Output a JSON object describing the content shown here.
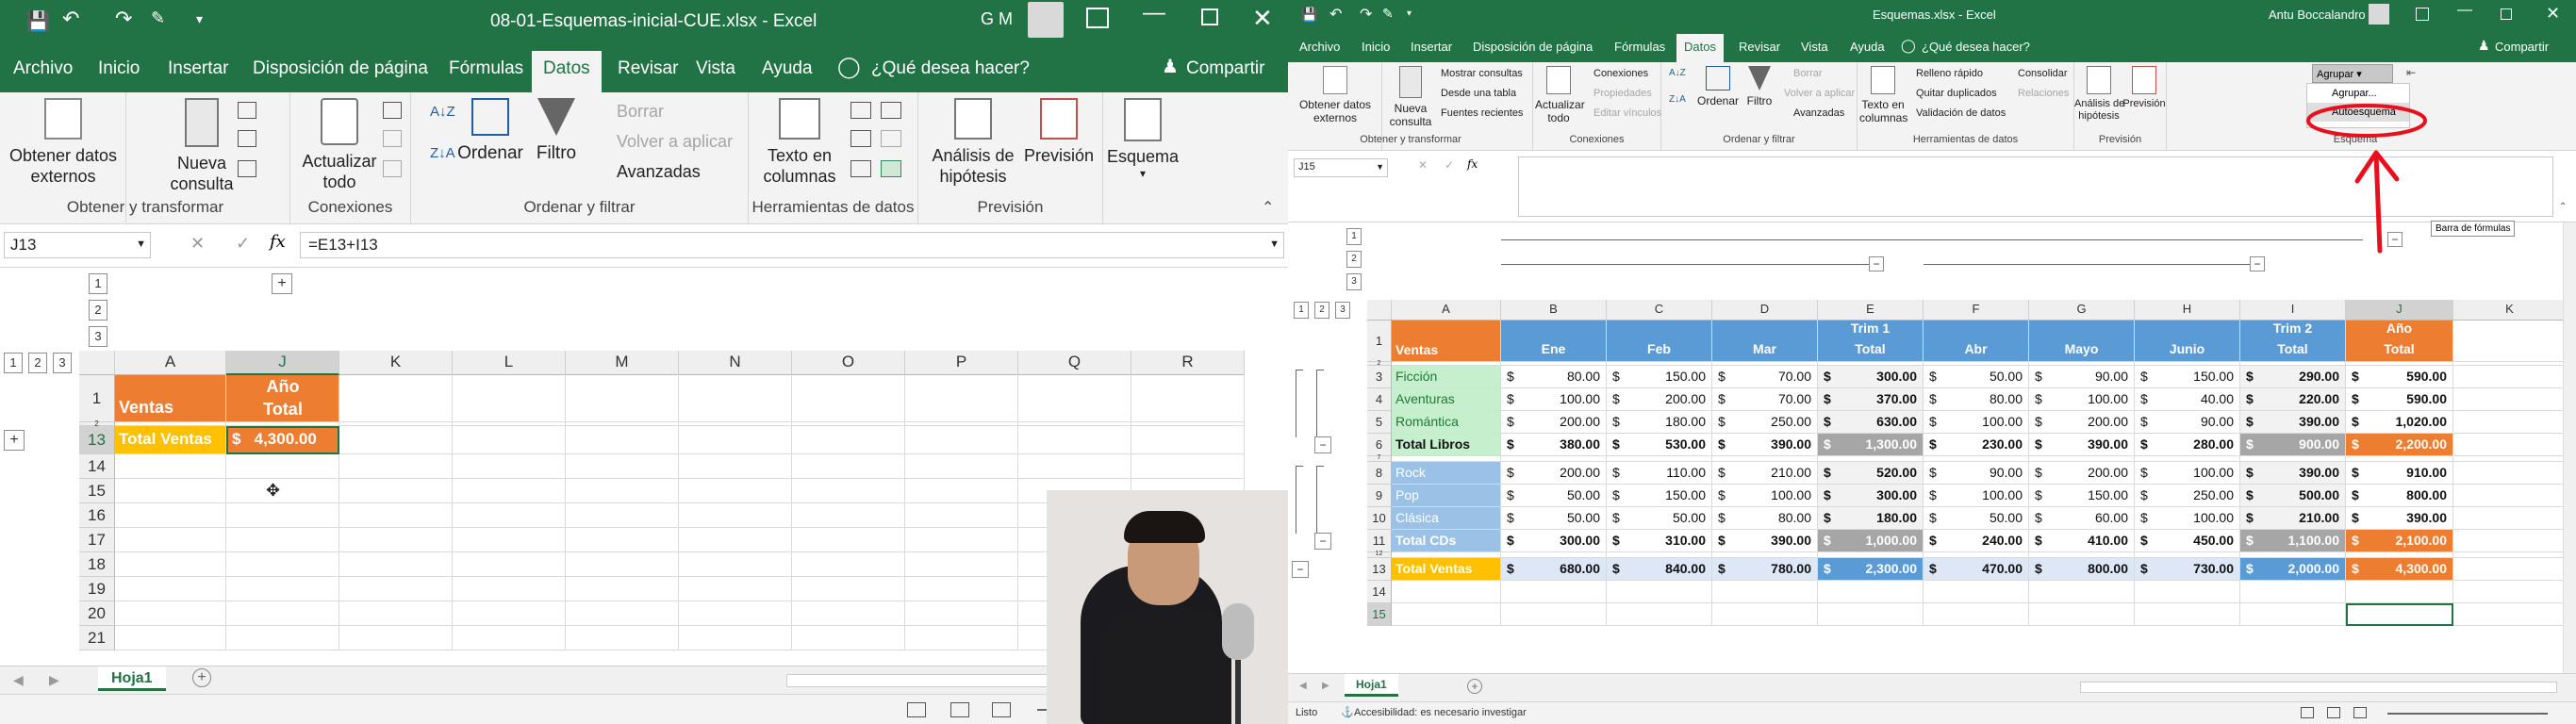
{
  "left": {
    "title": "08-01-Esquemas-inicial-CUE.xlsx  -  Excel",
    "user_initials": "G M",
    "tabs": [
      "Archivo",
      "Inicio",
      "Insertar",
      "Disposición de página",
      "Fórmulas",
      "Datos",
      "Revisar",
      "Vista",
      "Ayuda"
    ],
    "tell_me": "¿Qué desea hacer?",
    "share": "Compartir",
    "ribbon": {
      "obtener_line1": "Obtener datos",
      "obtener_line2": "externos",
      "nueva_line1": "Nueva",
      "nueva_line2": "consulta",
      "actualizar_line1": "Actualizar",
      "actualizar_line2": "todo",
      "ordenar": "Ordenar",
      "filtro": "Filtro",
      "borrar": "Borrar",
      "volver": "Volver a aplicar",
      "avanzadas": "Avanzadas",
      "texto_line1": "Texto en",
      "texto_line2": "columnas",
      "analisis_line1": "Análisis de",
      "analisis_line2": "hipótesis",
      "prevision": "Previsión",
      "esquema": "Esquema",
      "g_obtener": "Obtener y transformar",
      "g_conexiones": "Conexiones",
      "g_ordenar": "Ordenar y filtrar",
      "g_herr": "Herramientas de datos",
      "g_prev": "Previsión"
    },
    "name_box": "J13",
    "formula": "=E13+I13",
    "col_headers": [
      "A",
      "J",
      "K",
      "L",
      "M",
      "N",
      "O",
      "P",
      "Q",
      "R"
    ],
    "row_numbers": [
      "1",
      "2",
      "13",
      "14",
      "15",
      "16",
      "17",
      "18",
      "19",
      "20",
      "21"
    ],
    "outline_levels": [
      "1",
      "2",
      "3"
    ],
    "outline_col_levels": [
      "1",
      "2",
      "3"
    ],
    "expand_symbol": "+",
    "a1": "Ventas",
    "j1_line1": "Año",
    "j1_line2": "Total",
    "a13": "Total Ventas",
    "j13": "$   4,300.00",
    "sheet_tab": "Hoja1",
    "add_sheet": "+"
  },
  "right": {
    "title": "Esquemas.xlsx  -  Excel",
    "user_name": "Antu Boccalandro",
    "tabs": [
      "Archivo",
      "Inicio",
      "Insertar",
      "Disposición de página",
      "Fórmulas",
      "Datos",
      "Revisar",
      "Vista",
      "Ayuda"
    ],
    "tell_me": "¿Qué desea hacer?",
    "share": "Compartir",
    "ribbon": {
      "obtener_line1": "Obtener datos",
      "obtener_line2": "externos",
      "nueva_line1": "Nueva",
      "nueva_line2": "consulta",
      "mostrar": "Mostrar consultas",
      "desde": "Desde una tabla",
      "fuentes": "Fuentes recientes",
      "actualizar_line1": "Actualizar",
      "actualizar_line2": "todo",
      "conexiones": "Conexiones",
      "propiedades": "Propiedades",
      "editar": "Editar vínculos",
      "ordenar": "Ordenar",
      "filtro": "Filtro",
      "borrar": "Borrar",
      "volver": "Volver a aplicar",
      "avanzadas": "Avanzadas",
      "texto_line1": "Texto en",
      "texto_line2": "columnas",
      "relleno": "Relleno rápido",
      "quitar": "Quitar duplicados",
      "validacion": "Validación de datos",
      "consolidar": "Consolidar",
      "relaciones": "Relaciones",
      "analisis_line1": "Análisis de",
      "analisis_line2": "hipótesis",
      "prevision": "Previsión",
      "agrupar": "Agrupar",
      "agrupar_menu1": "Agrupar...",
      "agrupar_menu2": "Autoesquema",
      "g_obtener": "Obtener y transformar",
      "g_conexiones": "Conexiones",
      "g_ordenar": "Ordenar y filtrar",
      "g_herr": "Herramientas de datos",
      "g_prev": "Previsión",
      "g_esquema": "Esquema"
    },
    "name_box": "J15",
    "formula": "",
    "tooltip": "Barra de fórmulas",
    "outline_row_levels": [
      "1",
      "2",
      "3"
    ],
    "outline_col_levels": [
      "1",
      "2",
      "3"
    ],
    "collapse_symbol": "−",
    "col_headers": [
      "A",
      "B",
      "C",
      "D",
      "E",
      "F",
      "G",
      "H",
      "I",
      "J",
      "K"
    ],
    "header_row": [
      "Ventas",
      "Ene",
      "Feb",
      "Mar",
      "Trim 1 Total",
      "Abr",
      "Mayo",
      "Junio",
      "Trim 2 Total",
      "Año Total"
    ],
    "rows": [
      {
        "num": "3",
        "label": "Ficción",
        "vals": [
          "80.00",
          "150.00",
          "70.00",
          "300.00",
          "50.00",
          "90.00",
          "150.00",
          "290.00",
          "590.00"
        ]
      },
      {
        "num": "4",
        "label": "Aventuras",
        "vals": [
          "100.00",
          "200.00",
          "70.00",
          "370.00",
          "80.00",
          "100.00",
          "40.00",
          "220.00",
          "590.00"
        ]
      },
      {
        "num": "5",
        "label": "Romántica",
        "vals": [
          "200.00",
          "180.00",
          "250.00",
          "630.00",
          "100.00",
          "200.00",
          "90.00",
          "390.00",
          "1,020.00"
        ]
      },
      {
        "num": "6",
        "label": "Total Libros",
        "vals": [
          "380.00",
          "530.00",
          "390.00",
          "1,300.00",
          "230.00",
          "390.00",
          "280.00",
          "900.00",
          "2,200.00"
        ]
      },
      {
        "num": "8",
        "label": "Rock",
        "vals": [
          "200.00",
          "110.00",
          "210.00",
          "520.00",
          "90.00",
          "200.00",
          "100.00",
          "390.00",
          "910.00"
        ]
      },
      {
        "num": "9",
        "label": "Pop",
        "vals": [
          "50.00",
          "150.00",
          "100.00",
          "300.00",
          "100.00",
          "150.00",
          "250.00",
          "500.00",
          "800.00"
        ]
      },
      {
        "num": "10",
        "label": "Clásica",
        "vals": [
          "50.00",
          "50.00",
          "80.00",
          "180.00",
          "50.00",
          "60.00",
          "100.00",
          "210.00",
          "390.00"
        ]
      },
      {
        "num": "11",
        "label": "Total CDs",
        "vals": [
          "300.00",
          "310.00",
          "390.00",
          "1,000.00",
          "240.00",
          "410.00",
          "450.00",
          "1,100.00",
          "2,100.00"
        ]
      },
      {
        "num": "13",
        "label": "Total Ventas",
        "vals": [
          "680.00",
          "840.00",
          "780.00",
          "2,300.00",
          "470.00",
          "800.00",
          "730.00",
          "2,000.00",
          "4,300.00"
        ]
      }
    ],
    "row1_num": "1",
    "row14_num": "14",
    "row15_num": "15",
    "row7_num": "7",
    "row12_num": "12",
    "row2_num": "2",
    "currency": "$",
    "sheet_tab": "Hoja1",
    "add_sheet": "+",
    "status_ready": "Listo",
    "status_access": "Accesibilidad: es necesario investigar"
  },
  "colors": {
    "excel_green": "#217346",
    "orange": "#ed7d31",
    "blue_header": "#5b9bd5",
    "light_green": "#c6efce",
    "light_blue": "#9bc2e6",
    "yellow": "#ffc000",
    "grey_total": "#a6a6a6",
    "annotation_red": "#e8101d"
  }
}
